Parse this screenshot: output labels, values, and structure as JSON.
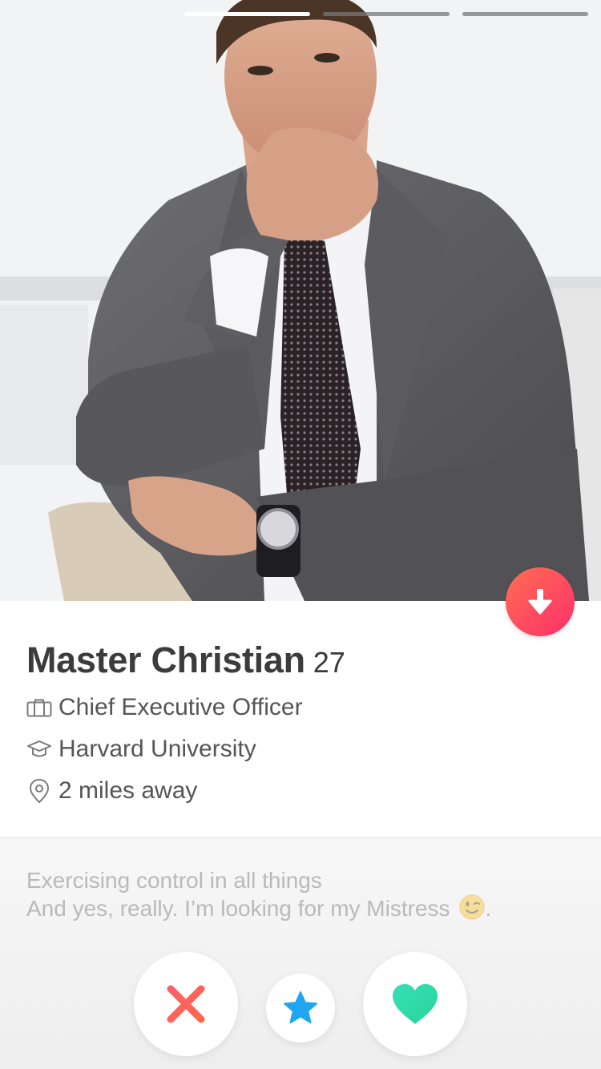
{
  "photo": {
    "description_icon": "profile-photo",
    "progress_segments": 3,
    "active_segment": 0
  },
  "profile": {
    "name": "Master Christian",
    "age": "27",
    "job": "Chief Executive Officer",
    "school": "Harvard University",
    "distance": "2 miles away"
  },
  "bio": {
    "line1": "Exercising control in all things",
    "line2": "And yes, really. I’m looking for my Mistress",
    "line2_end": "."
  },
  "icons": {
    "info": "arrow-down-icon",
    "job": "briefcase-icon",
    "school": "graduation-cap-icon",
    "distance": "location-pin-icon",
    "nope": "x-icon",
    "superlike": "star-icon",
    "like": "heart-icon"
  },
  "colors": {
    "brand_gradient_start": "#ff6e50",
    "brand_gradient_end": "#fd2f6c",
    "nope": "#fd4f64",
    "superlike": "#29a8f5",
    "like": "#3be2b2"
  }
}
